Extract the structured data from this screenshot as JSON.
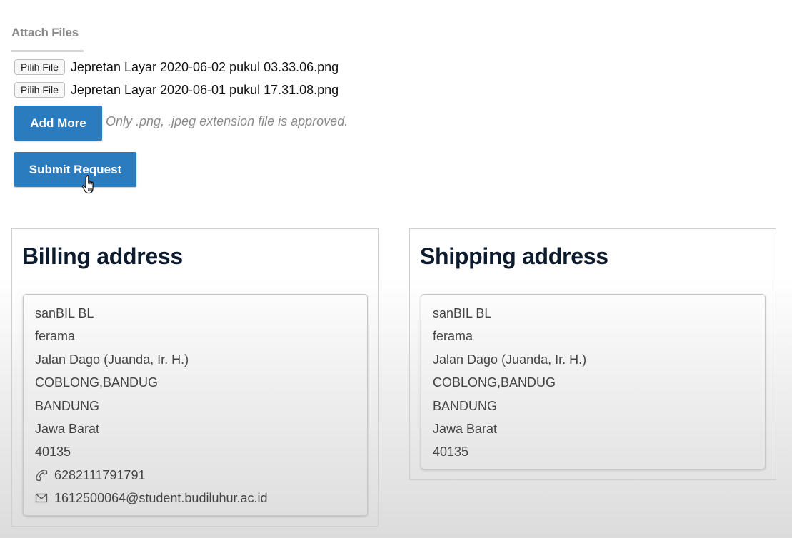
{
  "attach": {
    "heading": "Attach Files",
    "files": [
      {
        "button_label": "Pilih File",
        "file_name": "Jepretan Layar 2020-06-02 pukul 03.33.06.png"
      },
      {
        "button_label": "Pilih File",
        "file_name": "Jepretan Layar 2020-06-01 pukul 17.31.08.png"
      }
    ],
    "add_more_label": "Add More",
    "hint": "Only .png, .jpeg extension file is approved.",
    "submit_label": "Submit Request"
  },
  "billing": {
    "title": "Billing address",
    "lines": [
      "sanBIL BL",
      "ferama",
      "Jalan Dago (Juanda, Ir. H.)",
      "COBLONG,BANDUG",
      "BANDUNG",
      "Jawa Barat",
      "40135"
    ],
    "phone": "6282111791791",
    "email": "1612500064@student.budiluhur.ac.id"
  },
  "shipping": {
    "title": "Shipping address",
    "lines": [
      "sanBIL BL",
      "ferama",
      "Jalan Dago (Juanda, Ir. H.)",
      "COBLONG,BANDUG",
      "BANDUNG",
      "Jawa Barat",
      "40135"
    ]
  },
  "icons": {
    "phone": "phone-icon",
    "email": "envelope-icon",
    "cursor": "hand-pointer-icon"
  },
  "colors": {
    "button_blue": "#2b7bbf",
    "title_navy": "#0d1b2e",
    "muted_gray": "#8a8a8a"
  }
}
